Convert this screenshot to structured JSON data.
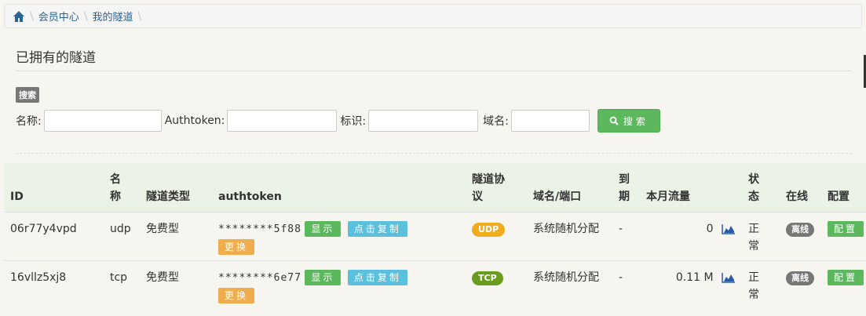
{
  "breadcrumb": {
    "home_icon": "home-icon",
    "items": [
      "会员中心",
      "我的隧道"
    ]
  },
  "page_title": "已拥有的隧道",
  "search": {
    "badge": "搜索",
    "fields": [
      {
        "label": "名称:",
        "value": ""
      },
      {
        "label": "Authtoken:",
        "value": ""
      },
      {
        "label": "标识:",
        "value": ""
      },
      {
        "label": "域名:",
        "value": ""
      }
    ],
    "button_label": "搜索",
    "button_icon": "search-icon"
  },
  "table": {
    "headers": [
      "ID",
      "名\n称",
      "隧道类型",
      "authtoken",
      "隧道协\n议",
      "域名/端口",
      "到\n期",
      "本月流量",
      "状\n态",
      "在线",
      "配置"
    ],
    "rows": [
      {
        "id": "06r77y4vpd",
        "name": "udp",
        "type": "免费型",
        "token": "********5f88",
        "show": "显示",
        "copy": "点击复制",
        "change": "更换",
        "protocol": "UDP",
        "domain": "系统随机分配",
        "expire": "-",
        "traffic": "0",
        "status": "正常",
        "online": "离线",
        "config": "配置"
      },
      {
        "id": "16vllz5xj8",
        "name": "tcp",
        "type": "免费型",
        "token": "********6e77",
        "show": "显示",
        "copy": "点击复制",
        "change": "更换",
        "protocol": "TCP",
        "domain": "系统随机分配",
        "expire": "-",
        "traffic": "0.11 M",
        "status": "正常",
        "online": "离线",
        "config": "配置"
      }
    ]
  },
  "colors": {
    "link": "#2a6496",
    "green": "#5cb85c",
    "blue": "#5bc0de",
    "orange": "#f0ad4e",
    "udp": "#f0ad1e",
    "tcp": "#6a9c20"
  }
}
